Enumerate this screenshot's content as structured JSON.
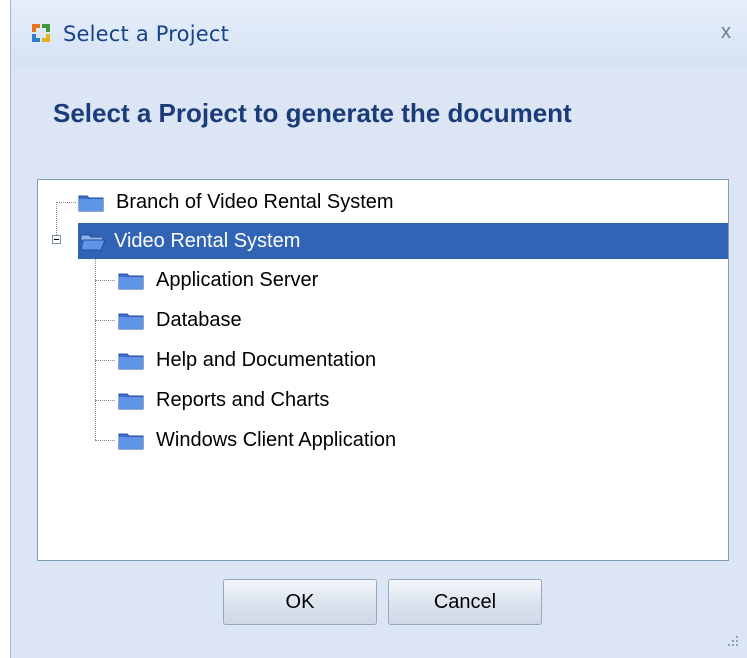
{
  "window": {
    "title": "Select a Project",
    "close_label": "x",
    "app_icon": "app-logo-icon"
  },
  "heading": "Select a Project to generate the document",
  "tree": {
    "nodes": [
      {
        "label": "Branch of Video Rental System",
        "level": 0,
        "expanded": false,
        "selected": false
      },
      {
        "label": "Video Rental System",
        "level": 0,
        "expanded": true,
        "selected": true
      },
      {
        "label": "Application Server",
        "level": 1,
        "selected": false
      },
      {
        "label": "Database",
        "level": 1,
        "selected": false
      },
      {
        "label": "Help and Documentation",
        "level": 1,
        "selected": false
      },
      {
        "label": "Reports and Charts",
        "level": 1,
        "selected": false
      },
      {
        "label": "Windows Client Application",
        "level": 1,
        "selected": false
      }
    ]
  },
  "buttons": {
    "ok_label": "OK",
    "cancel_label": "Cancel"
  },
  "colors": {
    "selection": "#3264b6",
    "heading": "#1b3c7a",
    "title": "#15428b",
    "dialog_bg": "#dbe5f3"
  }
}
